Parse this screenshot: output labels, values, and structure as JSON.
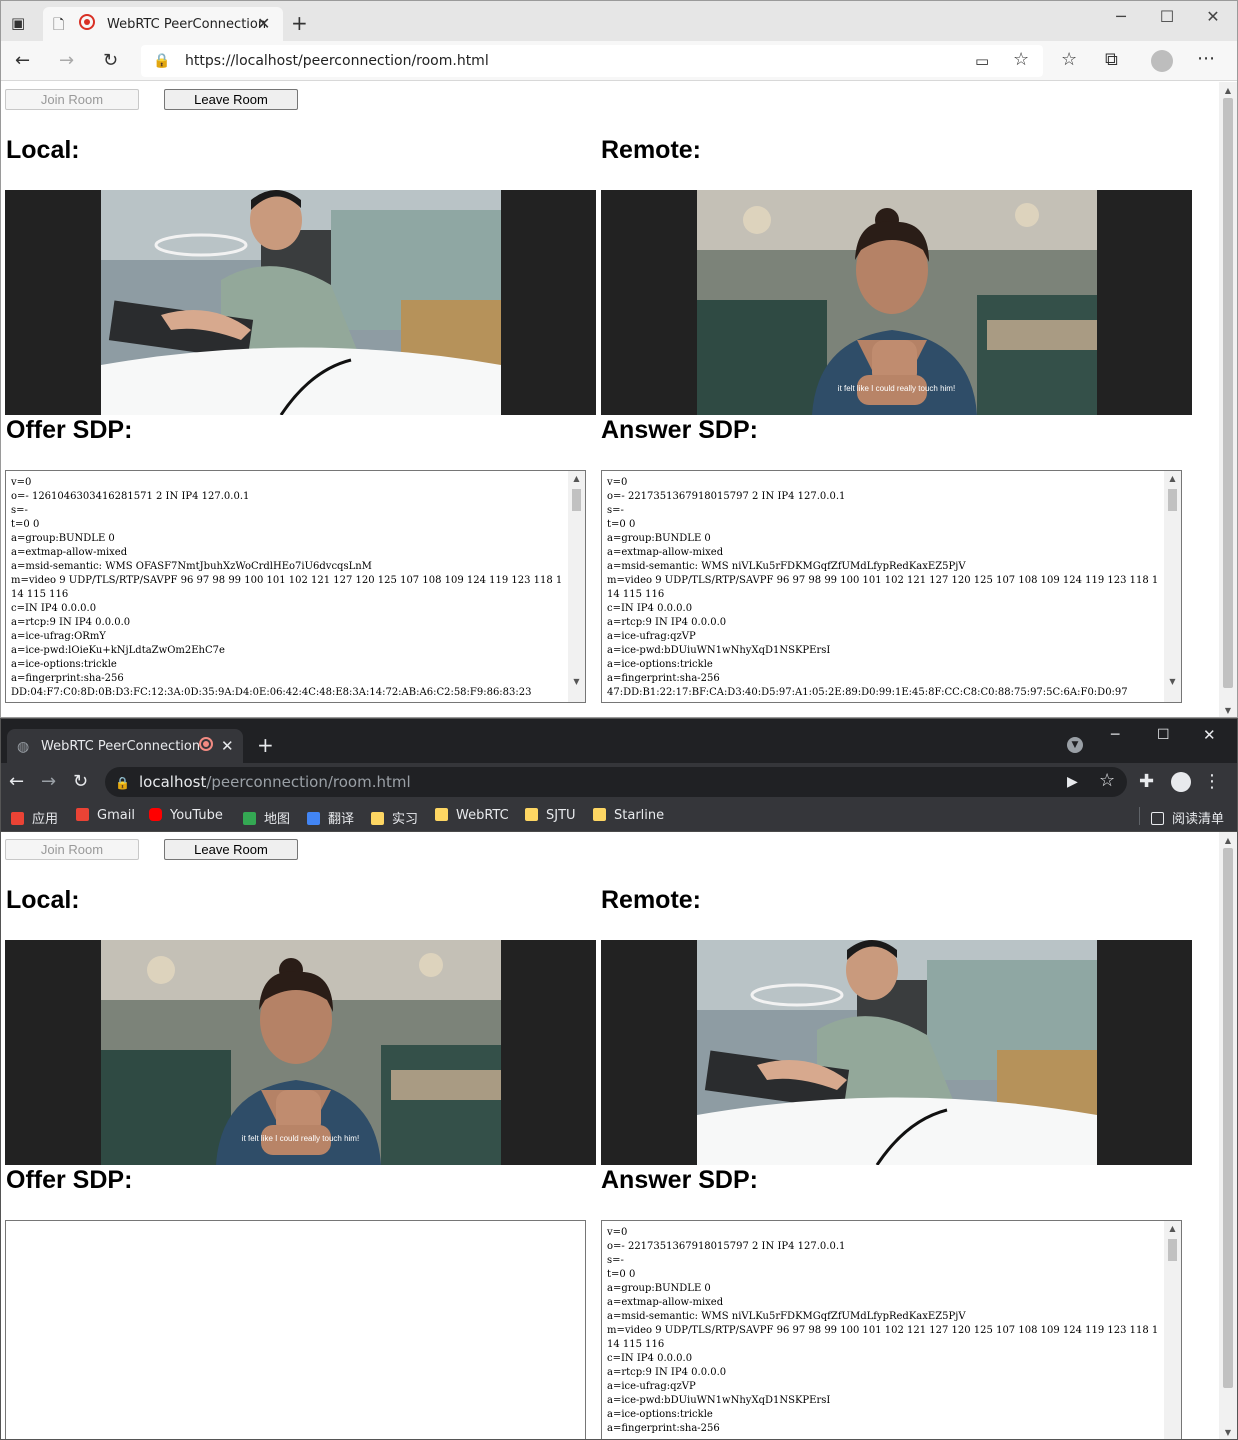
{
  "edge": {
    "tab": {
      "title": "WebRTC PeerConnection"
    },
    "address": {
      "url": "https://localhost/peerconnection/room.html"
    }
  },
  "chrome": {
    "tab": {
      "title": "WebRTC PeerConnection"
    },
    "address": {
      "host": "localhost",
      "path": "/peerconnection/room.html"
    },
    "bookmarks": [
      {
        "label": "应用",
        "color": "#ea4335"
      },
      {
        "label": "Gmail",
        "color": "#ea4335"
      },
      {
        "label": "YouTube",
        "color": "#ff0000"
      },
      {
        "label": "地图",
        "color": "#34a853"
      },
      {
        "label": "翻译",
        "color": "#4285f4"
      },
      {
        "label": "实习",
        "color": "#fdd663"
      },
      {
        "label": "WebRTC",
        "color": "#fdd663"
      },
      {
        "label": "SJTU",
        "color": "#fdd663"
      },
      {
        "label": "Starline",
        "color": "#fdd663"
      }
    ],
    "reading_list": "阅读清单"
  },
  "page": {
    "join_label": "Join Room",
    "leave_label": "Leave Room",
    "local_heading": "Local:",
    "remote_heading": "Remote:",
    "offer_heading": "Offer SDP:",
    "answer_heading": "Answer SDP:",
    "caption": "it felt like I could really touch him!"
  },
  "sdp": {
    "offer_1": "v=0\no=- 1261046303416281571 2 IN IP4 127.0.0.1\ns=-\nt=0 0\na=group:BUNDLE 0\na=extmap-allow-mixed\na=msid-semantic: WMS OFASF7NmtJbuhXzWoCrdlHEo7iU6dvcqsLnM\nm=video 9 UDP/TLS/RTP/SAVPF 96 97 98 99 100 101 102 121 127 120 125 107 108 109 124 119 123 118 114 115 116\nc=IN IP4 0.0.0.0\na=rtcp:9 IN IP4 0.0.0.0\na=ice-ufrag:ORmY\na=ice-pwd:lOieKu+kNjLdtaZwOm2EhC7e\na=ice-options:trickle\na=fingerprint:sha-256\nDD:04:F7:C0:8D:0B:D3:FC:12:3A:0D:35:9A:D4:0E:06:42:4C:48:E8:3A:14:72:AB:A6:C2:58:F9:86:83:23",
    "answer_1": "v=0\no=- 2217351367918015797 2 IN IP4 127.0.0.1\ns=-\nt=0 0\na=group:BUNDLE 0\na=extmap-allow-mixed\na=msid-semantic: WMS niVLKu5rFDKMGqfZfUMdLfypRedKaxEZ5PjV\nm=video 9 UDP/TLS/RTP/SAVPF 96 97 98 99 100 101 102 121 127 120 125 107 108 109 124 119 123 118 114 115 116\nc=IN IP4 0.0.0.0\na=rtcp:9 IN IP4 0.0.0.0\na=ice-ufrag:qzVP\na=ice-pwd:bDUiuWN1wNhyXqD1NSKPErsI\na=ice-options:trickle\na=fingerprint:sha-256\n47:DD:B1:22:17:BF:CA:D3:40:D5:97:A1:05:2E:89:D0:99:1E:45:8F:CC:C8:C0:88:75:97:5C:6A:F0:D0:97",
    "offer_2": "",
    "answer_2": "v=0\no=- 2217351367918015797 2 IN IP4 127.0.0.1\ns=-\nt=0 0\na=group:BUNDLE 0\na=extmap-allow-mixed\na=msid-semantic: WMS niVLKu5rFDKMGqfZfUMdLfypRedKaxEZ5PjV\nm=video 9 UDP/TLS/RTP/SAVPF 96 97 98 99 100 101 102 121 127 120 125 107 108 109 124 119 123 118 114 115 116\nc=IN IP4 0.0.0.0\na=rtcp:9 IN IP4 0.0.0.0\na=ice-ufrag:qzVP\na=ice-pwd:bDUiuWN1wNhyXqD1NSKPErsI\na=ice-options:trickle\na=fingerprint:sha-256"
  }
}
